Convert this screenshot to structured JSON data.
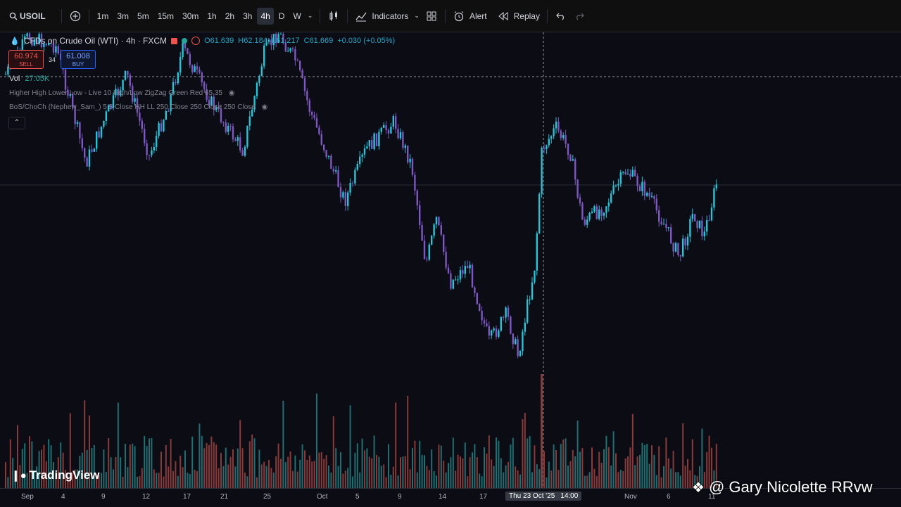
{
  "toolbar": {
    "symbol": "USOIL",
    "timeframes": [
      "1m",
      "3m",
      "5m",
      "15m",
      "30m",
      "1h",
      "2h",
      "3h",
      "4h",
      "D",
      "W"
    ],
    "active_timeframe": "4h",
    "indicators_label": "Indicators",
    "alert_label": "Alert",
    "replay_label": "Replay"
  },
  "legend": {
    "title": "CFDs on Crude Oil (WTI) · 4h · FXCM",
    "open": "O61.639",
    "high": "H62.184",
    "low": "L61.217",
    "close": "C61.669",
    "change": "+0.030 (+0.05%)"
  },
  "trade": {
    "sell_price": "60.974",
    "sell_label": "SELL",
    "buy_price": "61.008",
    "buy_label": "BUY",
    "spread": "34"
  },
  "indicators": {
    "vol_label": "Vol",
    "vol_value": "27.05K",
    "line1": "Higher High Lower Low - Live 10 High/Low ZigZag Green Red 65 35",
    "line2": "BoS/ChoCh (Nephew_Sam_) 5 5 Close HH LL 250 Close 250 Close 250 Close"
  },
  "xaxis": {
    "labels": [
      "Sep",
      "4",
      "9",
      "12",
      "17",
      "21",
      "25",
      "Oct",
      "5",
      "9",
      "14",
      "17",
      "Nov",
      "6",
      "11"
    ],
    "crosshair_label": "Thu 23 Oct '25",
    "crosshair_time": "14:00"
  },
  "branding": {
    "logo_text": "TradingView",
    "watermark": "@ Gary Nicolette RRvw"
  },
  "colors": {
    "up": "#26c6da",
    "down": "#7e57c2",
    "vol_up": "#1f6f73",
    "vol_down": "#8b3a3a",
    "background": "#0b0c14"
  },
  "chart_data": {
    "type": "candlestick",
    "title": "CFDs on Crude Oil (WTI) · 4h · FXCM",
    "x": [
      "Sep",
      "4",
      "9",
      "12",
      "17",
      "21",
      "25",
      "Oct",
      "5",
      "9",
      "14",
      "17",
      "23 Oct",
      "Nov",
      "6",
      "11"
    ],
    "close": [
      63.6,
      63.2,
      64.0,
      63.4,
      64.2,
      63.6,
      65.2,
      64.6,
      62.3,
      62.0,
      62.6,
      61.8,
      60.6,
      58.9,
      57.8,
      58.4,
      58.0,
      57.4,
      57.2,
      58.8,
      61.6,
      61.4,
      60.6,
      60.2,
      61.1,
      60.7,
      60.0,
      60.4,
      60.9,
      61.7
    ],
    "volume_visible": true
  }
}
